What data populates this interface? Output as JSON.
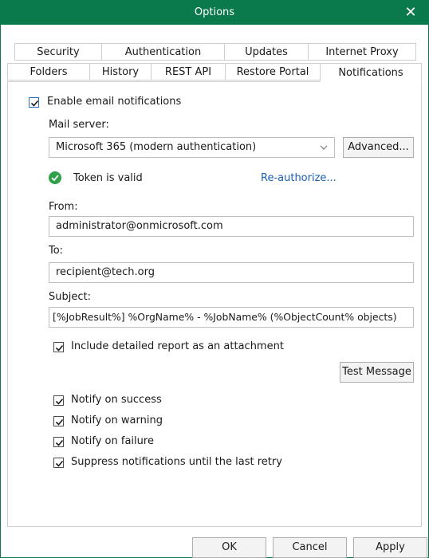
{
  "window": {
    "title": "Options",
    "close_symbol": "✕"
  },
  "tabs": {
    "row_top": [
      "Security",
      "Authentication",
      "Updates",
      "Internet Proxy"
    ],
    "row_bottom": [
      "Folders",
      "History",
      "REST API",
      "Restore Portal",
      "Notifications"
    ],
    "active": "Notifications"
  },
  "notifications": {
    "enable_label": "Enable email notifications",
    "enable_checked": true,
    "mail_server_label": "Mail server:",
    "mail_server_value": "Microsoft 365 (modern authentication)",
    "advanced_label": "Advanced...",
    "token_status": "Token is valid",
    "reauthorize_label": "Re-authorize...",
    "from_label": "From:",
    "from_value": "administrator@onmicrosoft.com",
    "to_label": "To:",
    "to_value": "recipient@tech.org",
    "subject_label": "Subject:",
    "subject_value": "[%JobResult%] %OrgName% - %JobName% (%ObjectCount% objects)",
    "include_report_label": "Include detailed report as an attachment",
    "test_message_label": "Test Message",
    "notify_success_label": "Notify on success",
    "notify_warning_label": "Notify on warning",
    "notify_failure_label": "Notify on failure",
    "suppress_label": "Suppress notifications until the last retry"
  },
  "footer": {
    "ok_label": "OK",
    "cancel_label": "Cancel",
    "apply_label": "Apply"
  },
  "colors": {
    "accent": "#0a7a4d",
    "link": "#1a5fb4",
    "success": "#2fa14a"
  }
}
